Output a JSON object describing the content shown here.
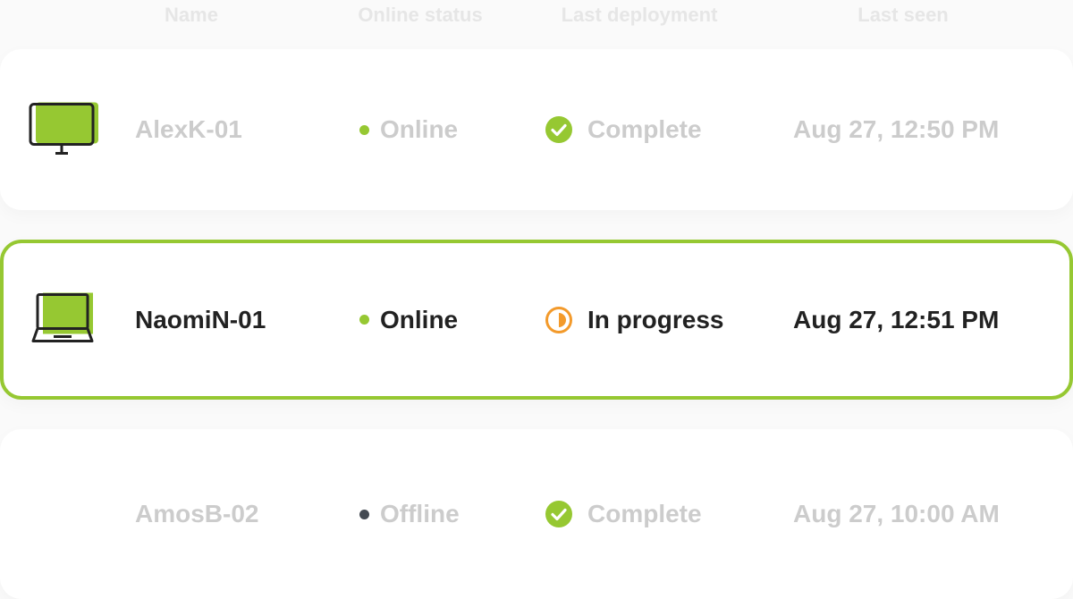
{
  "header": {
    "name": "Name",
    "online_status": "Online status",
    "last_deployment": "Last deployment",
    "last_seen": "Last seen"
  },
  "colors": {
    "accent": "#96c832",
    "online": "#96c832",
    "offline": "#444a52",
    "in_progress": "#f39a2b"
  },
  "rows": [
    {
      "device_icon": "monitor-icon",
      "name": "AlexK-01",
      "status": "Online",
      "status_color": "#96c832",
      "deployment": "Complete",
      "deployment_icon": "check-circle-icon",
      "last_seen": "Aug 27, 12:50 PM",
      "selected": false
    },
    {
      "device_icon": "laptop-icon",
      "name": "NaomiN-01",
      "status": "Online",
      "status_color": "#96c832",
      "deployment": "In progress",
      "deployment_icon": "half-circle-progress-icon",
      "last_seen": "Aug 27, 12:51 PM",
      "selected": true
    },
    {
      "device_icon": "",
      "name": "AmosB-02",
      "status": "Offline",
      "status_color": "#444a52",
      "deployment": "Complete",
      "deployment_icon": "check-circle-icon",
      "last_seen": "Aug 27, 10:00 AM",
      "selected": false
    }
  ]
}
